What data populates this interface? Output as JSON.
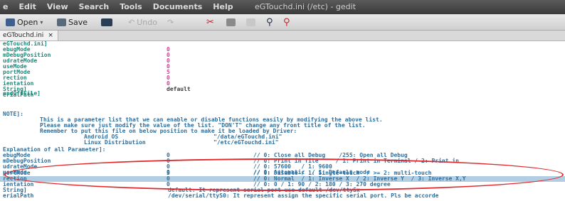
{
  "window": {
    "title": "eGTouchd.ini (/etc) - gedit",
    "menu": [
      "e",
      "Edit",
      "View",
      "Search",
      "Tools",
      "Documents",
      "Help"
    ]
  },
  "toolbar": {
    "open_label": "Open",
    "save_label": "Save",
    "undo_label": "Undo"
  },
  "tab": {
    "label": "eGTouchd.ini",
    "close": "×"
  },
  "editor": {
    "settings": [
      {
        "key": "eGTouchd.ini]",
        "value": ""
      },
      {
        "key": "ebugMode",
        "value": "0"
      },
      {
        "key": "mDebugPosition",
        "value": "0"
      },
      {
        "key": "udrateMode",
        "value": "0"
      },
      {
        "key": "useMode",
        "value": "0"
      },
      {
        "key": "portMode",
        "value": "5"
      },
      {
        "key": "rection",
        "value": "0"
      },
      {
        "key": "ientation",
        "value": "0"
      },
      {
        "key": "String]",
        "value": ""
      },
      {
        "key": "erialPath",
        "value": "default"
      },
      {
        "key": "",
        "value": ""
      },
      {
        "key": "endOffFile]",
        "value": ""
      }
    ],
    "note_header": "NOTE]:",
    "note_lines": [
      "This is a parameter list that we can enable or disable functions easily by modifying the above list.",
      "Please make sure just modify the value of the list. \"DON'T\" change any front title of the list.",
      "Remember to put this file on below position to make it be loaded by Driver:"
    ],
    "paths": [
      {
        "os": "Android OS",
        "path": "\"/data/eGTouchd.ini\""
      },
      {
        "os": "Linux Distribution",
        "path": "\"/etc/eGTouchd.ini\""
      }
    ],
    "explanation_header": "Explanation of all Parameter]:",
    "params": [
      {
        "key": "ebugMode",
        "value": "0",
        "comment": "// 0: Close all Debug    /255: Open all Debug"
      },
      {
        "key": "mDebugPosition",
        "value": "0",
        "comment": "// 0: Print in file     / 1: Print in Terminal / 2: Print in"
      },
      {
        "key": "udrateMode",
        "value": "0",
        "comment": "// 0: 57600   / 1: 9600"
      },
      {
        "key": "useMode",
        "value": "0",
        "comment": "// 0: Automatic  / 1: Default mode"
      },
      {
        "key": "portMode",
        "value": "5",
        "comment": "// 0: Disable / 1: Single-touch  / >= 2: multi-touch"
      },
      {
        "key": "rection",
        "value": "0",
        "comment": "// 0: Normal  / 1: Inverse X  / 2: Inverse Y  / 3: Inverse X,Y"
      },
      {
        "key": "ientation",
        "value": "0",
        "comment": "// 0: 0 / 1: 90 / 2: 180 / 3: 270 degree"
      },
      {
        "key": "String]",
        "value": "",
        "comment": ""
      },
      {
        "key": "erialPath",
        "value": "",
        "comment": "default: It represent serial port use default /dev/ttySx"
      }
    ],
    "tail_line": "/dev/serial/ttyS0: It represent assign the specific serial port. Pls be accorde"
  },
  "colors": {
    "key": "#1d8a7a",
    "value": "#ee2faa",
    "comment": "#2d6f9e",
    "highlight": "#9ec2dc",
    "annotation_oval": "#e0282c"
  }
}
